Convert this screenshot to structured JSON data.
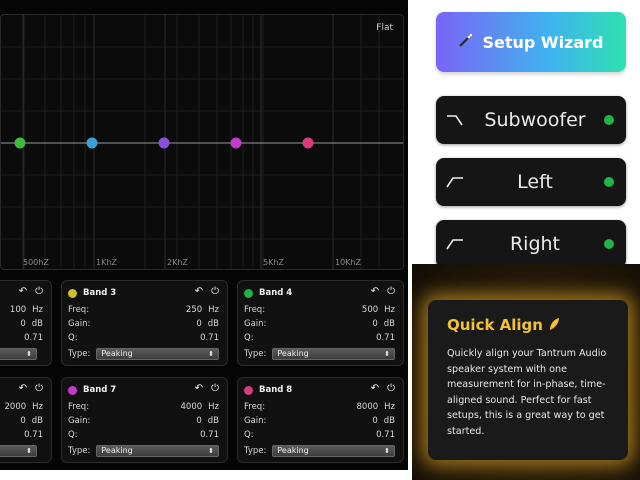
{
  "graph": {
    "preset_label": "Flat",
    "freq_labels": [
      "500hZ",
      "1KhZ",
      "2KhZ",
      "5KhZ",
      "10KhZ"
    ],
    "points": [
      {
        "color": "#3dbb3d"
      },
      {
        "color": "#3aa0d8"
      },
      {
        "color": "#8a4fd8"
      },
      {
        "color": "#c33cc8"
      },
      {
        "color": "#d83c7a"
      }
    ]
  },
  "labels": {
    "freq": "Freq:",
    "gain": "Gain:",
    "q": "Q:",
    "type": "Type:",
    "hz": "Hz",
    "db": "dB"
  },
  "bands_top": [
    {
      "name": "",
      "color": "",
      "freq": "100",
      "gain": "0",
      "q": "0.71",
      "type": ""
    },
    {
      "name": "Band 3",
      "color": "#c9c22a",
      "freq": "250",
      "gain": "0",
      "q": "0.71",
      "type": "Peaking"
    },
    {
      "name": "Band 4",
      "color": "#1fb34a",
      "freq": "500",
      "gain": "0",
      "q": "0.71",
      "type": "Peaking"
    }
  ],
  "bands_bottom": [
    {
      "name": "",
      "color": "",
      "freq": "2000",
      "gain": "0",
      "q": "0.71",
      "type": ""
    },
    {
      "name": "Band 7",
      "color": "#c33cc8",
      "freq": "4000",
      "gain": "0",
      "q": "0.71",
      "type": "Peaking"
    },
    {
      "name": "Band 8",
      "color": "#d83c7a",
      "freq": "8000",
      "gain": "0",
      "q": "0.71",
      "type": "Peaking"
    }
  ],
  "wizard": {
    "label": "Setup Wizard",
    "icon": "magic-wand-icon"
  },
  "speakers": [
    {
      "label": "Subwoofer",
      "icon": "high-cut-filter-icon",
      "status_color": "#1fb34a"
    },
    {
      "label": "Left",
      "icon": "low-cut-filter-icon",
      "status_color": "#1fb34a"
    },
    {
      "label": "Right",
      "icon": "low-cut-filter-icon",
      "status_color": "#1fb34a"
    }
  ],
  "quick_align": {
    "title": "Quick Align",
    "icon": "feather-icon",
    "body": "Quickly align your Tantrum Audio speaker system with one measurement for in-phase, time-aligned sound. Perfect for fast setups, this is a great way to get started."
  },
  "colors": {
    "accent_gold": "#f3c233",
    "status_green": "#1fb34a"
  }
}
